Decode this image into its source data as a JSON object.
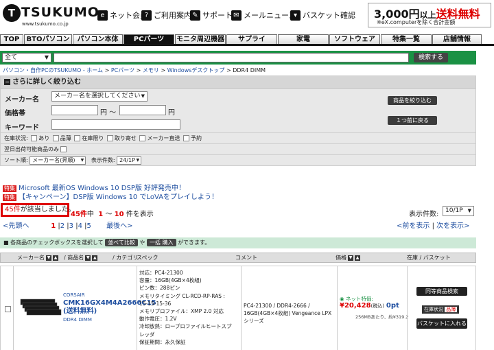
{
  "header": {
    "logo_text": "TSUKUMO",
    "logo_url": "www.tsukumo.co.jp",
    "links": [
      {
        "label": "ネット会員",
        "icon": "membership-icon"
      },
      {
        "label": "ご利用案内",
        "icon": "help-phone-icon"
      },
      {
        "label": "サポート",
        "icon": "support-pen-icon"
      },
      {
        "label": "メールニュース",
        "icon": "mail-icon"
      },
      {
        "label": "バスケット確認",
        "icon": "basket-icon"
      }
    ],
    "shipping": {
      "amount": "3,000円",
      "above": "以上",
      "free": "送料無料",
      "note": "※eX.computerを除く合計金額"
    }
  },
  "nav": {
    "tabs": [
      "TOP",
      "BTOパソコン",
      "パソコン本体",
      "PCパーツ",
      "モニタ周辺機器",
      "サプライ",
      "家電",
      "ソフトウェア",
      "特集一覧",
      "店舗情報"
    ],
    "active": "PCパーツ"
  },
  "search": {
    "category": "全て",
    "button": "検索する"
  },
  "breadcrumb": [
    "パソコン・自作PCのTSUKUMO - ホーム",
    "PCパーツ",
    "メモリ",
    "Windowsデスクトップ",
    "DDR4 DIMM"
  ],
  "refine": {
    "title": "さらに詳しく絞り込む",
    "maker_label": "メーカー名",
    "maker_placeholder": "メーカー名を選択してください",
    "price_label": "価格帯",
    "price_yen": "円",
    "price_tilde": "円 ～",
    "keyword_label": "キーワード",
    "narrow_button": "商品を絞り込む",
    "back_button": "１つ前に戻る",
    "stock_label": "在庫状況:",
    "stock_options": [
      "あり",
      "品薄",
      "在庫限り",
      "取り寄せ",
      "メーカー直送",
      "予約"
    ],
    "nextday_label": "翌日出荷可能商品のみ",
    "sort_label": "ソート順:",
    "sort_value": "メーカー名(昇順)",
    "display_label": "表示件数:",
    "display_value": "24/1P"
  },
  "announcements": [
    {
      "tag": "特集",
      "text": "Microsoft 最新OS Windows 10 DSP版 好評発売中！"
    },
    {
      "tag": "特集",
      "text": "【キャンペーン】DSP版 Windows 10 でLoVAをプレイしよう！"
    }
  ],
  "results": {
    "count_num": "45件",
    "count_text": "が該当しました。",
    "summary_total": "45件",
    "summary_mid": "中",
    "summary_from": "1",
    "summary_tilde": "～",
    "summary_to": "10",
    "summary_end": "件を表示",
    "per_page_label": "表示件数:",
    "per_page_value": "10/1P",
    "prev": "<先頭へ",
    "pages": [
      "1",
      "2",
      "3",
      "4",
      "5"
    ],
    "last": "最後へ>",
    "prev_page": "<前を表示",
    "next_page": "次を表示>"
  },
  "compare_bar": {
    "prefix": "各商品のチェックボックスを選択して",
    "compare_btn": "並べて比較",
    "or": "や",
    "bulk_btn": "一括 購入",
    "suffix": "ができます。"
  },
  "table": {
    "headers": {
      "maker": "メーカー名",
      "product": "/ 商品名",
      "category": "/ カテゴリ",
      "spec": "スペック",
      "comment": "コメント",
      "price": "価格",
      "stock": "在庫 / バスケット"
    },
    "row": {
      "maker": "CORSAIR",
      "name": "CMK16GX4M4A2666C15 (送料無料)",
      "category": "DDR4 DIMM",
      "spec": [
        "対応：PC4-21300",
        "容量：16GB(4GB×4枚組)",
        "ピン数：288ピン",
        "メモリタイミング CL-RCD-RP-RAS :",
        "15-15-15-36",
        "メモリプロファイル：XMP 2.0 対応",
        "動作電圧：1.2V",
        "冷却放熱：ロープロファイルヒートスプ",
        "レッダ",
        "保証期間：永久保証"
      ],
      "comment": "PC4-21300 / DDR4-2666 / 16GB(4GB×4枚組) Vengeance LPXシリーズ",
      "price_label": "ネット特価:",
      "price": "¥20,428",
      "tax": "(税込)",
      "points": "0pt",
      "per_mb": "256MBあたり、約¥319.2",
      "same_btn": "同等商品検索",
      "stock_label": "在庫状況",
      "stock_value": "品薄",
      "basket_btn": "バスケットに入れる"
    }
  }
}
